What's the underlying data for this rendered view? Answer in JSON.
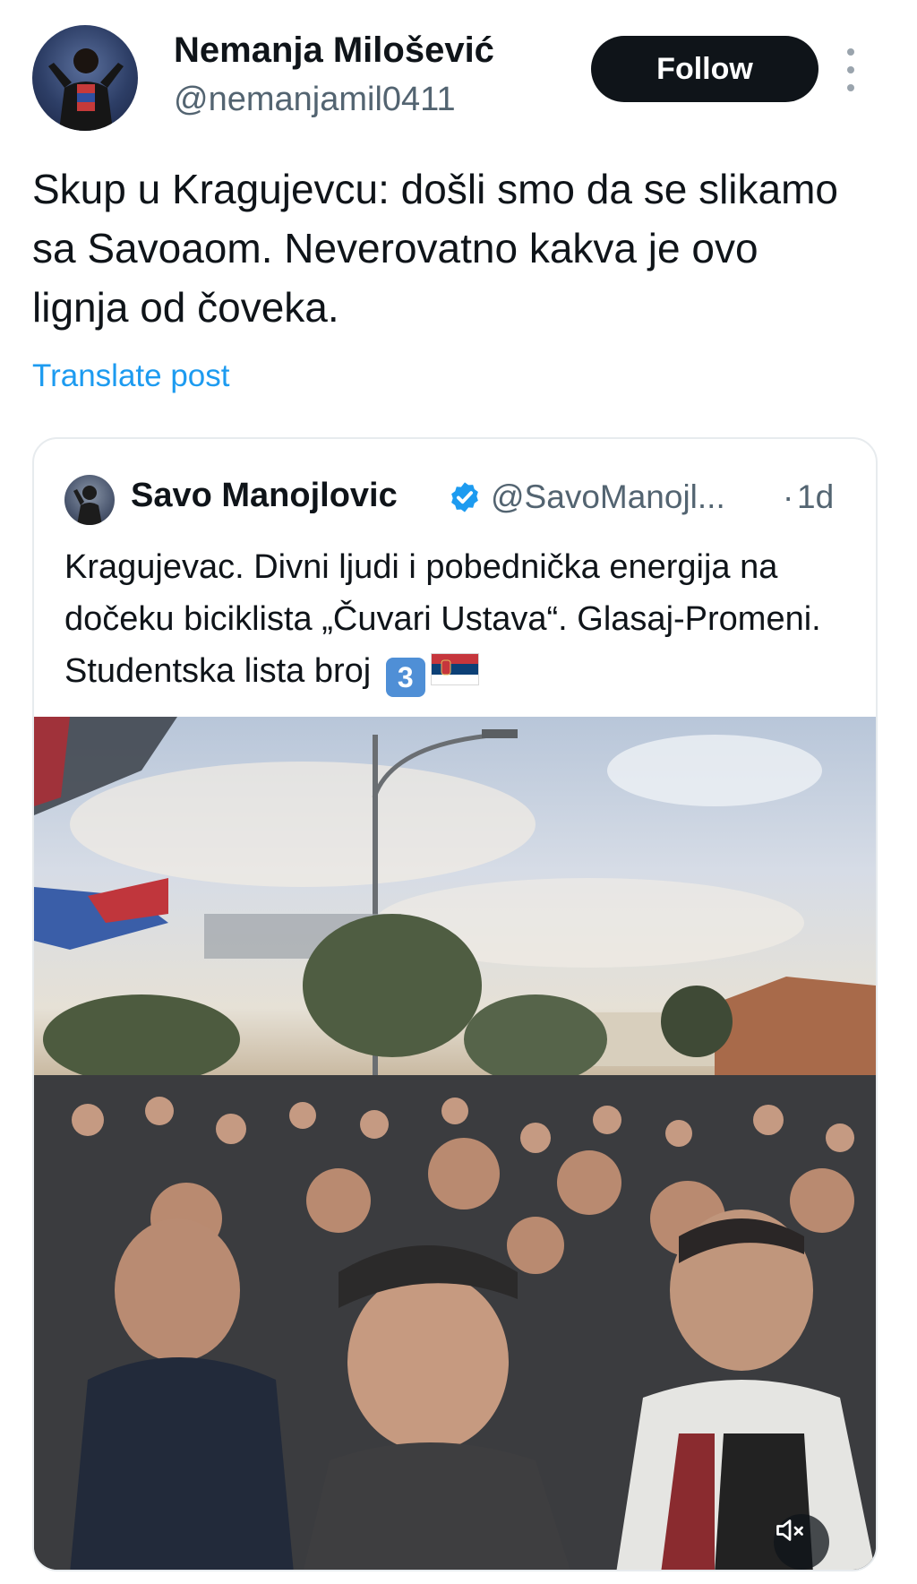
{
  "author": {
    "name": "Nemanja Milošević",
    "handle": "@nemanjamil0411",
    "avatar_icon": "profile-photo"
  },
  "actions": {
    "follow_label": "Follow",
    "more_icon": "vertical-ellipsis"
  },
  "post": {
    "text": "Skup u Kragujevcu: došli smo da se slikamo sa Savoaom. Neverovatno kakva je ovo lignja od čoveka.",
    "translate_label": "Translate post"
  },
  "quoted": {
    "name": "Savo Manojlovic",
    "verified_icon": "verified-badge",
    "handle": "@SavoManojl...",
    "separator": "·",
    "time": "1d",
    "text_main": "Kragujevac. Divni ljudi i pobednička energija na dočeku biciklista „Čuvari Ustava“. Glasaj-Promeni. Studentska lista broj",
    "keycap": "3",
    "flag_icon": "serbia-flag",
    "media": {
      "type": "video",
      "mute_icon": "speaker-muted"
    }
  },
  "colors": {
    "accent": "#1d9bf0",
    "text": "#0f1419",
    "secondary": "#536471",
    "follow_bg": "#0f1419",
    "border": "#e7ebee"
  }
}
